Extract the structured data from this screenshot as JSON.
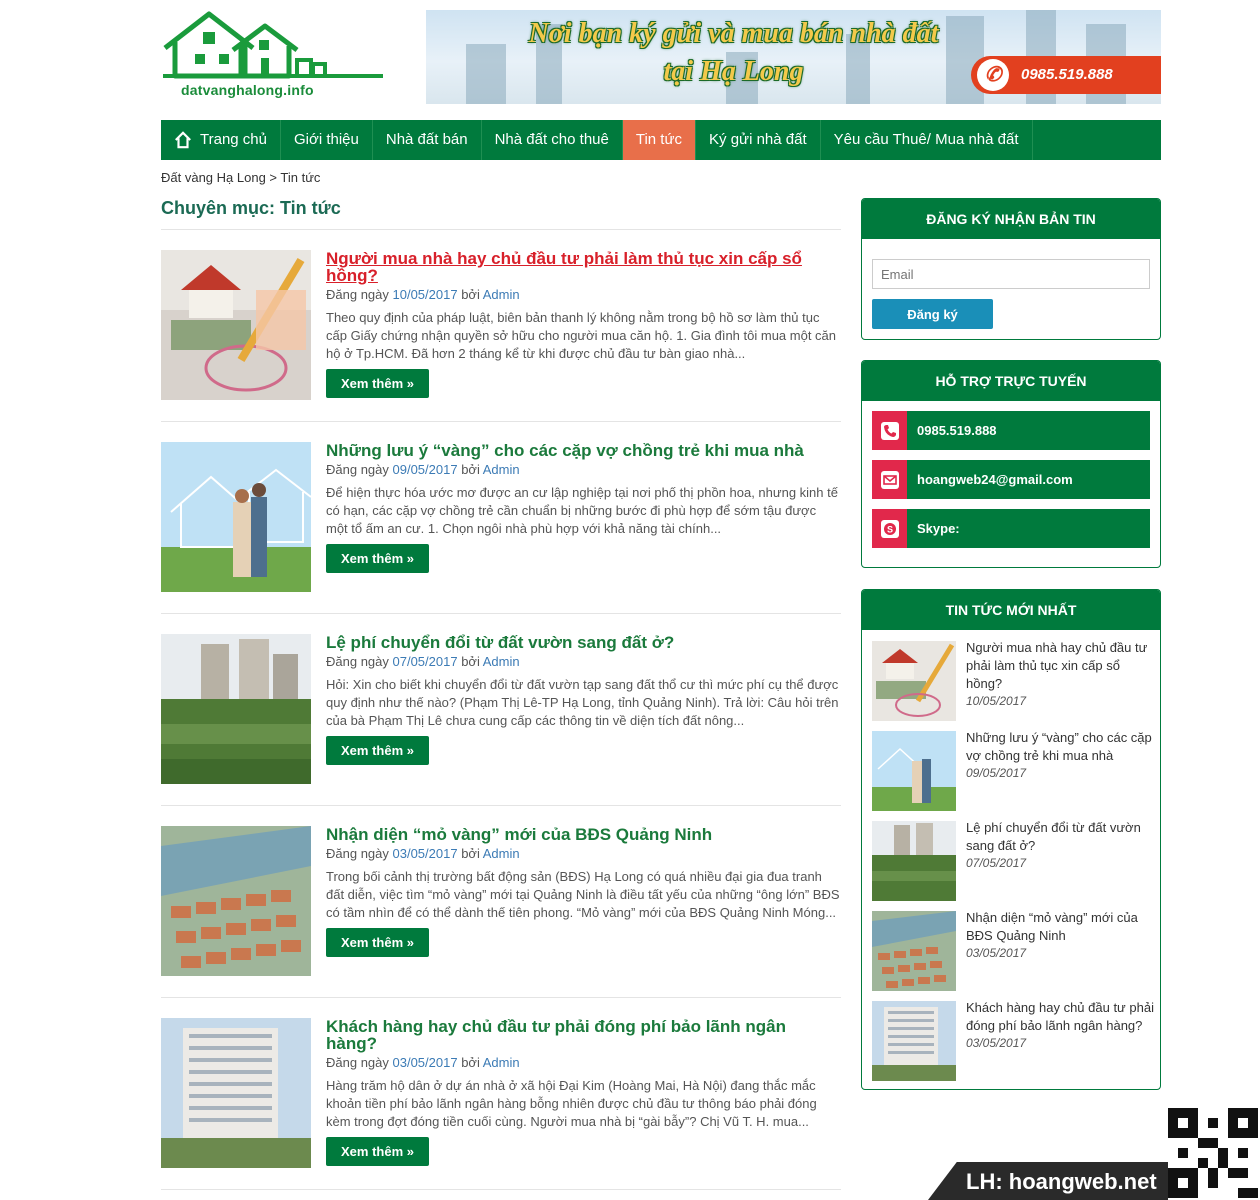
{
  "header": {
    "logo_text": "datvanghalong.info",
    "banner_line1": "Nơi bạn ký gửi và mua bán nhà đất",
    "banner_line2": "tại Hạ Long",
    "banner_phone": "0985.519.888"
  },
  "nav": {
    "items": [
      {
        "label": "Trang chủ"
      },
      {
        "label": "Giới thiệu"
      },
      {
        "label": "Nhà đất bán"
      },
      {
        "label": "Nhà đất cho thuê"
      },
      {
        "label": "Tin tức"
      },
      {
        "label": "Ký gửi nhà đất"
      },
      {
        "label": "Yêu cầu Thuê/ Mua nhà đất"
      }
    ],
    "active_index": 4,
    "color": "#007a3d",
    "active_color": "#e86f4a"
  },
  "breadcrumb": {
    "home": "Đất vàng Hạ Long",
    "sep": " > ",
    "current": "Tin tức"
  },
  "category_title": "Chuyên mục: Tin tức",
  "posts": [
    {
      "title": "Người mua nhà hay chủ đầu tư phải làm thủ tục xin cấp sổ hồng?",
      "meta_prefix": "Đăng ngày ",
      "date": "10/05/2017",
      "by": " bởi ",
      "author": "Admin",
      "excerpt": "Theo quy định của pháp luật, biên bản thanh lý không nằm trong bộ hồ sơ làm thủ tục cấp Giấy chứng nhận quyền sở hữu cho người mua căn hộ. 1. Gia đình tôi mua một căn hộ ở Tp.HCM. Đã hơn 2 tháng kể từ khi được chủ đầu tư bàn giao nhà...",
      "more": "Xem thêm »"
    },
    {
      "title": "Những lưu ý “vàng” cho các cặp vợ chồng trẻ khi mua nhà",
      "meta_prefix": "Đăng ngày ",
      "date": "09/05/2017",
      "by": " bởi ",
      "author": "Admin",
      "excerpt": "Để hiện thực hóa ước mơ được an cư lập nghiệp tại nơi phố thị phồn hoa, nhưng kinh tế có hạn, các cặp vợ chồng trẻ cần chuẩn bị những bước đi phù hợp để sớm tậu được một tổ ấm an cư. 1. Chọn ngôi nhà phù hợp với khả năng tài chính...",
      "more": "Xem thêm »"
    },
    {
      "title": "Lệ phí chuyển đổi từ đất vườn sang đất ở?",
      "meta_prefix": "Đăng ngày ",
      "date": "07/05/2017",
      "by": " bởi ",
      "author": "Admin",
      "excerpt": "Hỏi: Xin cho biết khi chuyển đổi từ đất vườn tạp sang đất thổ cư thì mức phí cụ thể được quy định như thế nào? (Phạm Thị Lê-TP Hạ Long, tỉnh Quảng Ninh). Trả lời: Câu hỏi trên của bà Phạm Thị Lê chưa cung cấp các thông tin về diện tích đất nông...",
      "more": "Xem thêm »"
    },
    {
      "title": "Nhận diện “mỏ vàng” mới của BĐS Quảng Ninh",
      "meta_prefix": "Đăng ngày ",
      "date": "03/05/2017",
      "by": " bởi ",
      "author": "Admin",
      "excerpt": "Trong bối cảnh thị trường bất động sản (BĐS) Hạ Long có quá nhiều đại gia đua tranh đất diễn, việc tìm “mỏ vàng” mới tại Quảng Ninh là điều tất yếu của những “ông lớn” BĐS có tầm nhìn để có thể dành thế tiên phong. “Mỏ vàng” mới của BĐS Quảng Ninh Móng...",
      "more": "Xem thêm »"
    },
    {
      "title": "Khách hàng hay chủ đầu tư phải đóng phí bảo lãnh ngân hàng?",
      "meta_prefix": "Đăng ngày ",
      "date": "03/05/2017",
      "by": " bởi ",
      "author": "Admin",
      "excerpt": "Hàng trăm hộ dân ở dự án nhà ở xã hội Đại Kim (Hoàng Mai, Hà Nội) đang thắc mắc khoản tiền phí bảo lãnh ngân hàng bỗng nhiên được chủ đầu tư thông báo phải đóng kèm trong đợt đóng tiền cuối cùng. Người mua nhà bị “gài bẫy”? Chị Vũ T. H. mua...",
      "more": "Xem thêm »"
    }
  ],
  "sidebar": {
    "newsletter": {
      "title": "ĐĂNG KÝ NHẬN BẢN TIN",
      "email_placeholder": "Email",
      "button": "Đăng ký"
    },
    "support": {
      "title": "HỖ TRỢ TRỰC TUYẾN",
      "phone": "0985.519.888",
      "email": "hoangweb24@gmail.com",
      "skype": "Skype:"
    },
    "latest": {
      "title": "TIN TỨC MỚI NHẤT",
      "items": [
        {
          "title": "Người mua nhà hay chủ đầu tư phải làm thủ tục xin cấp sổ hồng?",
          "date": "10/05/2017"
        },
        {
          "title": "Những lưu ý “vàng” cho các cặp vợ chồng trẻ khi mua nhà",
          "date": "09/05/2017"
        },
        {
          "title": "Lệ phí chuyển đổi từ đất vườn sang đất ở?",
          "date": "07/05/2017"
        },
        {
          "title": "Nhận diện “mỏ vàng” mới của BĐS Quảng Ninh",
          "date": "03/05/2017"
        },
        {
          "title": "Khách hàng hay chủ đầu tư phải đóng phí bảo lãnh ngân hàng?",
          "date": "03/05/2017"
        }
      ]
    }
  },
  "corner_badge": "LH: hoangweb.net"
}
